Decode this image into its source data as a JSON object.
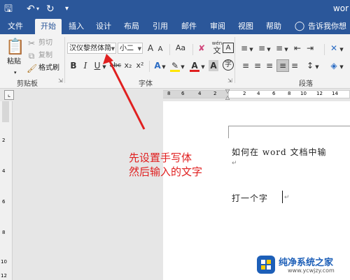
{
  "title_bar": {
    "doc_title": "wor",
    "save_icon": "save-icon",
    "undo_icon": "undo-icon",
    "redo_icon": "redo-icon"
  },
  "tabs": [
    "文件",
    "开始",
    "插入",
    "设计",
    "布局",
    "引用",
    "邮件",
    "审阅",
    "视图",
    "帮助"
  ],
  "active_tab": "开始",
  "tell_me": "告诉我你想要",
  "clipboard": {
    "paste": "粘贴",
    "cut": "剪切",
    "copy": "复制",
    "format_painter": "格式刷",
    "label": "剪贴板"
  },
  "font": {
    "name": "汉仪黎然体简",
    "size": "小二",
    "grow": "A",
    "shrink": "A",
    "case": "Aa",
    "phonetic": "wén",
    "bold": "B",
    "italic": "I",
    "underline": "U",
    "strike": "abc",
    "subscript": "x₂",
    "superscript": "x²",
    "enclosed": "字",
    "label": "字体"
  },
  "paragraph": {
    "label": "段落"
  },
  "ruler": {
    "h_ticks": [
      "8",
      "6",
      "4",
      "2",
      "2",
      "4",
      "6",
      "8",
      "10",
      "12",
      "14"
    ],
    "v_ticks": [
      "2",
      "4",
      "6",
      "8",
      "10",
      "12"
    ]
  },
  "annotation": {
    "line1": "先设置手写体",
    "line2": "然后输入的文字"
  },
  "document": {
    "line1": "如何在 word 文档中输",
    "line2": "打一个字"
  },
  "watermark": {
    "name": "纯净系统之家",
    "url": "www.ycwjzy.com"
  },
  "colors": {
    "brand": "#2b579a",
    "annotation": "#e02020",
    "logo_blue": "#1d5fb8"
  }
}
